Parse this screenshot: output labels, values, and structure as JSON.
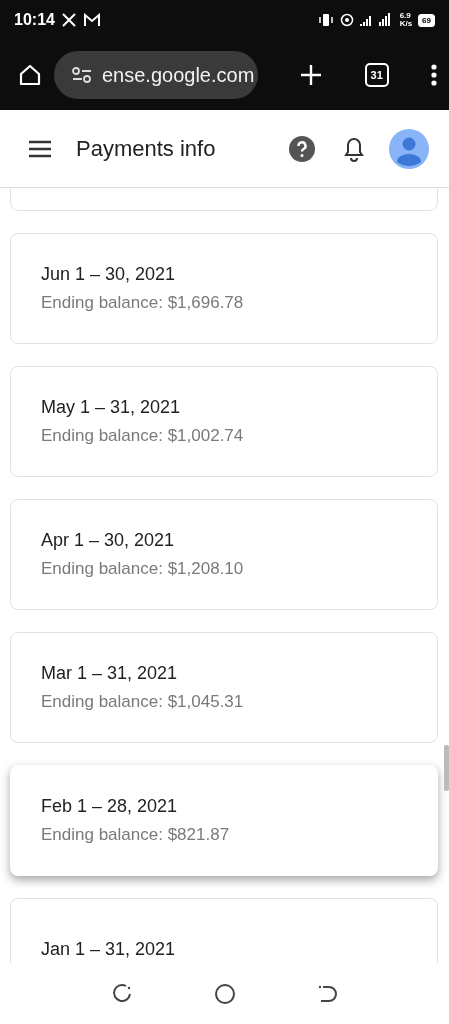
{
  "status_bar": {
    "time": "10:14",
    "speed": "6.9",
    "speed_unit": "K/s",
    "battery": "69"
  },
  "browser": {
    "url": "ense.google.com",
    "tab_count": "31"
  },
  "header": {
    "title": "Payments info"
  },
  "statements": [
    {
      "period": "Jun 1 – 30, 2021",
      "balance": "Ending balance: $1,696.78",
      "selected": false
    },
    {
      "period": "May 1 – 31, 2021",
      "balance": "Ending balance: $1,002.74",
      "selected": false
    },
    {
      "period": "Apr 1 – 30, 2021",
      "balance": "Ending balance: $1,208.10",
      "selected": false
    },
    {
      "period": "Mar 1 – 31, 2021",
      "balance": "Ending balance: $1,045.31",
      "selected": false
    },
    {
      "period": "Feb 1 – 28, 2021",
      "balance": "Ending balance: $821.87",
      "selected": true
    },
    {
      "period": "Jan 1 – 31, 2021",
      "selected": false
    }
  ]
}
